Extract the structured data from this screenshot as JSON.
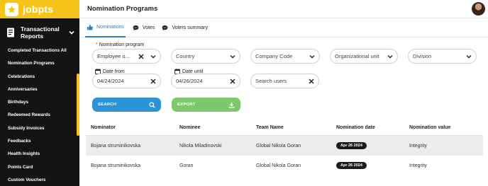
{
  "app": {
    "logo_text": "jobpts"
  },
  "sidebar": {
    "section_title": "Transactional Reports",
    "items": [
      {
        "label": "Completed Transactions All"
      },
      {
        "label": "Nomination Programs"
      },
      {
        "label": "Celebrations"
      },
      {
        "label": "Anniversaries"
      },
      {
        "label": "Birthdays"
      },
      {
        "label": "Redeemed Rewards"
      },
      {
        "label": "Subsidy Invoices"
      },
      {
        "label": "Feedbacks"
      },
      {
        "label": "Health Insights"
      },
      {
        "label": "Points Card"
      },
      {
        "label": "Custom Vouchers"
      }
    ]
  },
  "header": {
    "title": "Nomination Programs"
  },
  "tabs": [
    {
      "label": "Nominations",
      "icon": "thumbs-up-icon",
      "active": true
    },
    {
      "label": "Votes",
      "icon": "chat-icon",
      "active": false
    },
    {
      "label": "Voters summary",
      "icon": "chat-icon",
      "active": false
    }
  ],
  "filters": {
    "nomination_program": {
      "label": "Nomination program",
      "required_mark": "*",
      "value": "Employee o..."
    },
    "country": {
      "placeholder": "Country"
    },
    "company_code": {
      "placeholder": "Company Code"
    },
    "organizational_unit": {
      "placeholder": "Organizational unit"
    },
    "division": {
      "placeholder": "Division"
    },
    "date_from": {
      "label": "Date from",
      "value": "04/24/2024"
    },
    "date_until": {
      "label": "Date until",
      "value": "04/26/2024"
    },
    "search_users": {
      "placeholder": "Search users"
    }
  },
  "actions": {
    "search_label": "SEARCH",
    "export_label": "EXPORT"
  },
  "table": {
    "columns": [
      "Nominator",
      "Nominee",
      "Team Name",
      "Nomination date",
      "Nomination value"
    ],
    "rows": [
      {
        "nominator": "Bojana struminikovska",
        "nominee": "Nikola Miladinovski",
        "team": "Global Nikola Goran",
        "date": "Apr 26 2024",
        "value": "Integrity"
      },
      {
        "nominator": "Bojana struminikovska",
        "nominee": "Goran",
        "team": "Global Nikola Goran",
        "date": "Apr 26 2024",
        "value": "Integrity"
      }
    ]
  },
  "colors": {
    "brand_yellow": "#f6c419",
    "accent_blue": "#2d93d6",
    "export_green": "#7cc96d",
    "sidebar_bg": "#141414"
  }
}
